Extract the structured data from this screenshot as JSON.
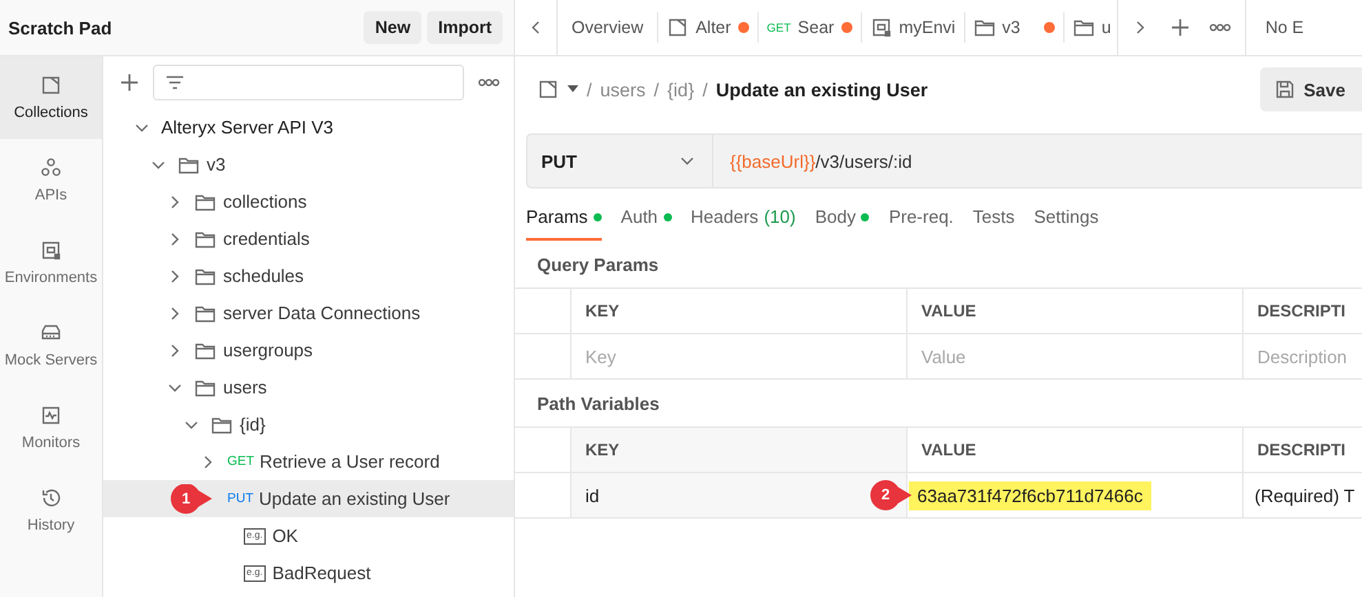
{
  "workspace": {
    "title": "Scratch Pad",
    "buttons": [
      "New",
      "Import"
    ]
  },
  "nav": [
    {
      "label": "Collections",
      "selected": true
    },
    {
      "label": "APIs",
      "selected": false
    },
    {
      "label": "Environments",
      "selected": false
    },
    {
      "label": "Mock Servers",
      "selected": false
    },
    {
      "label": "Monitors",
      "selected": false
    },
    {
      "label": "History",
      "selected": false
    }
  ],
  "tree": [
    {
      "kind": "collection",
      "label": "Alteryx Server API V3",
      "expanded": true,
      "selected": false,
      "children": [
        {
          "kind": "folder",
          "label": "v3",
          "expanded": true,
          "selected": false,
          "children": [
            {
              "kind": "folder",
              "label": "collections",
              "expanded": false,
              "selected": false
            },
            {
              "kind": "folder",
              "label": "credentials",
              "expanded": false,
              "selected": false
            },
            {
              "kind": "folder",
              "label": "schedules",
              "expanded": false,
              "selected": false
            },
            {
              "kind": "folder",
              "label": "server Data Connections",
              "expanded": false,
              "selected": false
            },
            {
              "kind": "folder",
              "label": "usergroups",
              "expanded": false,
              "selected": false
            },
            {
              "kind": "folder",
              "label": "users",
              "expanded": true,
              "selected": false,
              "children": [
                {
                  "kind": "folder",
                  "label": "{id}",
                  "expanded": true,
                  "selected": false,
                  "children": [
                    {
                      "kind": "request",
                      "method": "GET",
                      "label": "Retrieve a User record",
                      "expanded": false,
                      "selected": false
                    },
                    {
                      "kind": "request",
                      "method": "PUT",
                      "label": "Update an existing User",
                      "selected": true,
                      "callout": "1",
                      "children": [
                        {
                          "kind": "example",
                          "badge": "e.g.",
                          "label": "OK",
                          "selected": false
                        },
                        {
                          "kind": "example",
                          "badge": "e.g.",
                          "label": "BadRequest",
                          "selected": false
                        }
                      ]
                    }
                  ]
                }
              ]
            }
          ]
        }
      ]
    }
  ],
  "open_tabs": [
    {
      "kind": "overview",
      "label": "Overview",
      "modified": false
    },
    {
      "kind": "collection",
      "label": "Alter",
      "modified": true
    },
    {
      "kind": "request",
      "method": "GET",
      "label": "Sear",
      "modified": true
    },
    {
      "kind": "environment",
      "label": "myEnvi",
      "modified": false
    },
    {
      "kind": "folder",
      "label": "v3",
      "modified": true
    },
    {
      "kind": "folder",
      "label": "u",
      "modified": false
    }
  ],
  "environment_selector": "No E",
  "breadcrumb": [
    {
      "separator": "/",
      "label": "users"
    },
    {
      "separator": "/",
      "label": "{id}"
    }
  ],
  "title_separator": "/",
  "request_title": "Update an existing User",
  "save_button": "Save",
  "request": {
    "method": "PUT",
    "url_variable": "{{baseUrl}}",
    "url_path": "/v3/users/:id"
  },
  "request_tabs": [
    {
      "label": "Params",
      "selected": true,
      "dot": true
    },
    {
      "label": "Auth",
      "selected": false,
      "dot": true
    },
    {
      "label": "Headers",
      "count": "(10)",
      "selected": false,
      "dot": false
    },
    {
      "label": "Body",
      "selected": false,
      "dot": true
    },
    {
      "label": "Pre-req.",
      "selected": false,
      "dot": false
    },
    {
      "label": "Tests",
      "selected": false,
      "dot": false
    },
    {
      "label": "Settings",
      "selected": false,
      "dot": false
    }
  ],
  "query_params": {
    "title": "Query Params",
    "columns": [
      "KEY",
      "VALUE",
      "DESCRIPTI"
    ],
    "placeholders": [
      "Key",
      "Value",
      "Description"
    ]
  },
  "path_variables": {
    "title": "Path Variables",
    "columns": [
      "KEY",
      "VALUE",
      "DESCRIPTI"
    ],
    "rows": [
      {
        "key": "id",
        "value": "63aa731f472f6cb711d7466c",
        "value_highlighted": true,
        "callout": "2",
        "description": "(Required) T"
      }
    ]
  }
}
